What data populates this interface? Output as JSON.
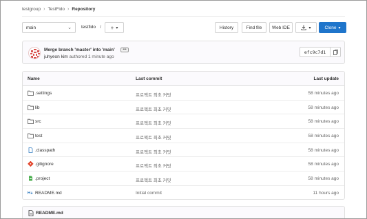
{
  "breadcrumb": {
    "items": [
      "testgroup",
      "TestFido",
      "Repository"
    ]
  },
  "toolbar": {
    "branch": "main",
    "path": "testfido",
    "path_sep": "/",
    "history_label": "History",
    "find_file_label": "Find file",
    "web_ide_label": "Web IDE",
    "clone_label": "Clone"
  },
  "last_commit": {
    "message": "Merge branch 'master' into 'main'",
    "author": "juhyeon kim",
    "action": "authored",
    "time": "1 minute ago",
    "sha": "efc9c7d1"
  },
  "file_table": {
    "headers": {
      "name": "Name",
      "last_commit": "Last commit",
      "last_update": "Last update"
    },
    "rows": [
      {
        "name": ".settings",
        "type": "folder",
        "commit": "프로젝트 최초 커밋",
        "updated": "58 minutes ago"
      },
      {
        "name": "lib",
        "type": "folder",
        "commit": "프로젝트 최초 커밋",
        "updated": "58 minutes ago"
      },
      {
        "name": "src",
        "type": "folder",
        "commit": "프로젝트 최초 커밋",
        "updated": "58 minutes ago"
      },
      {
        "name": "test",
        "type": "folder",
        "commit": "프로젝트 최초 커밋",
        "updated": "58 minutes ago"
      },
      {
        "name": ".classpath",
        "type": "file",
        "commit": "프로젝트 최초 커밋",
        "updated": "58 minutes ago"
      },
      {
        "name": ".gitignore",
        "type": "git",
        "commit": "프로젝트 최초 커밋",
        "updated": "58 minutes ago"
      },
      {
        "name": ".project",
        "type": "project",
        "commit": "프로젝트 최초 커밋",
        "updated": "58 minutes ago"
      },
      {
        "name": "README.md",
        "type": "markdown",
        "commit": "Initial commit",
        "updated": "11 hours ago"
      }
    ]
  },
  "readme": {
    "title": "README.md"
  },
  "colors": {
    "accent": "#1f75cb",
    "avatar": "#d9534f"
  }
}
